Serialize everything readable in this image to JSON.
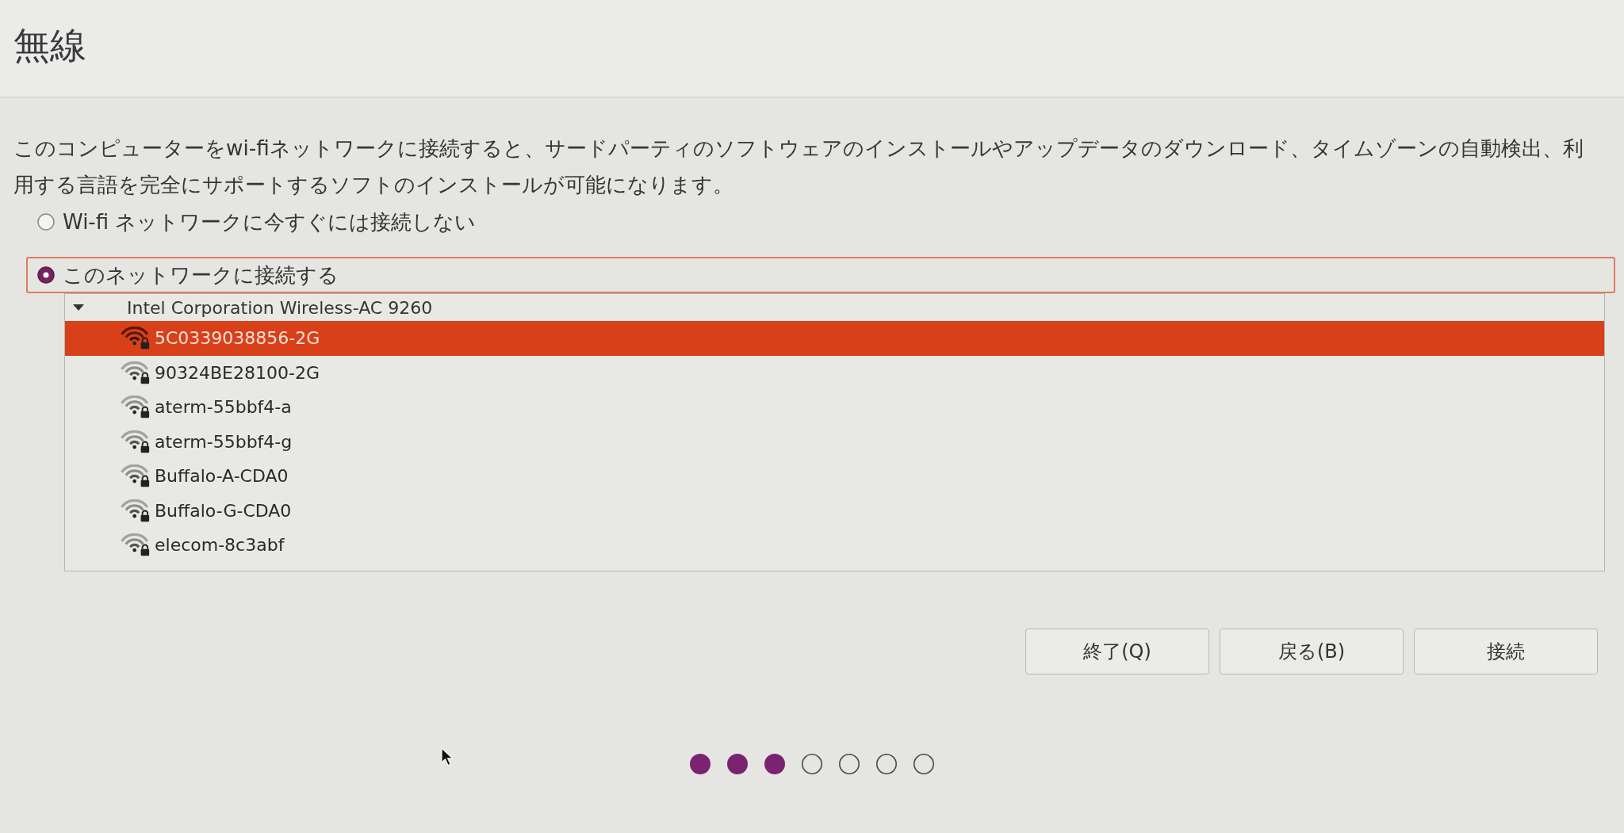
{
  "title": "無線",
  "description": "このコンピューターをwi-fiネットワークに接続すると、サードパーティのソフトウェアのインストールやアップデータのダウンロード、タイムゾーンの自動検出、利用する言語を完全にサポートするソフトのインストールが可能になります。",
  "connection_options": [
    {
      "label": "Wi-fi ネットワークに今すぐには接続しない",
      "selected": false
    },
    {
      "label": "このネットワークに接続する",
      "selected": true
    }
  ],
  "adapter": {
    "name": "Intel Corporation Wireless-AC 9260",
    "expanded": true,
    "networks": [
      {
        "ssid": "5C0339038856-2G",
        "selected": true
      },
      {
        "ssid": "90324BE28100-2G",
        "selected": false
      },
      {
        "ssid": "aterm-55bbf4-a",
        "selected": false
      },
      {
        "ssid": "aterm-55bbf4-g",
        "selected": false
      },
      {
        "ssid": "Buffalo-A-CDA0",
        "selected": false
      },
      {
        "ssid": "Buffalo-G-CDA0",
        "selected": false
      },
      {
        "ssid": "elecom-8c3abf",
        "selected": false
      }
    ]
  },
  "buttons": [
    {
      "label": "終了(Q)"
    },
    {
      "label": "戻る(B)"
    },
    {
      "label": "接続"
    }
  ],
  "progress_steps": [
    {
      "completed": true
    },
    {
      "completed": true
    },
    {
      "completed": true
    },
    {
      "completed": false
    },
    {
      "completed": false
    },
    {
      "completed": false
    },
    {
      "completed": false
    }
  ]
}
